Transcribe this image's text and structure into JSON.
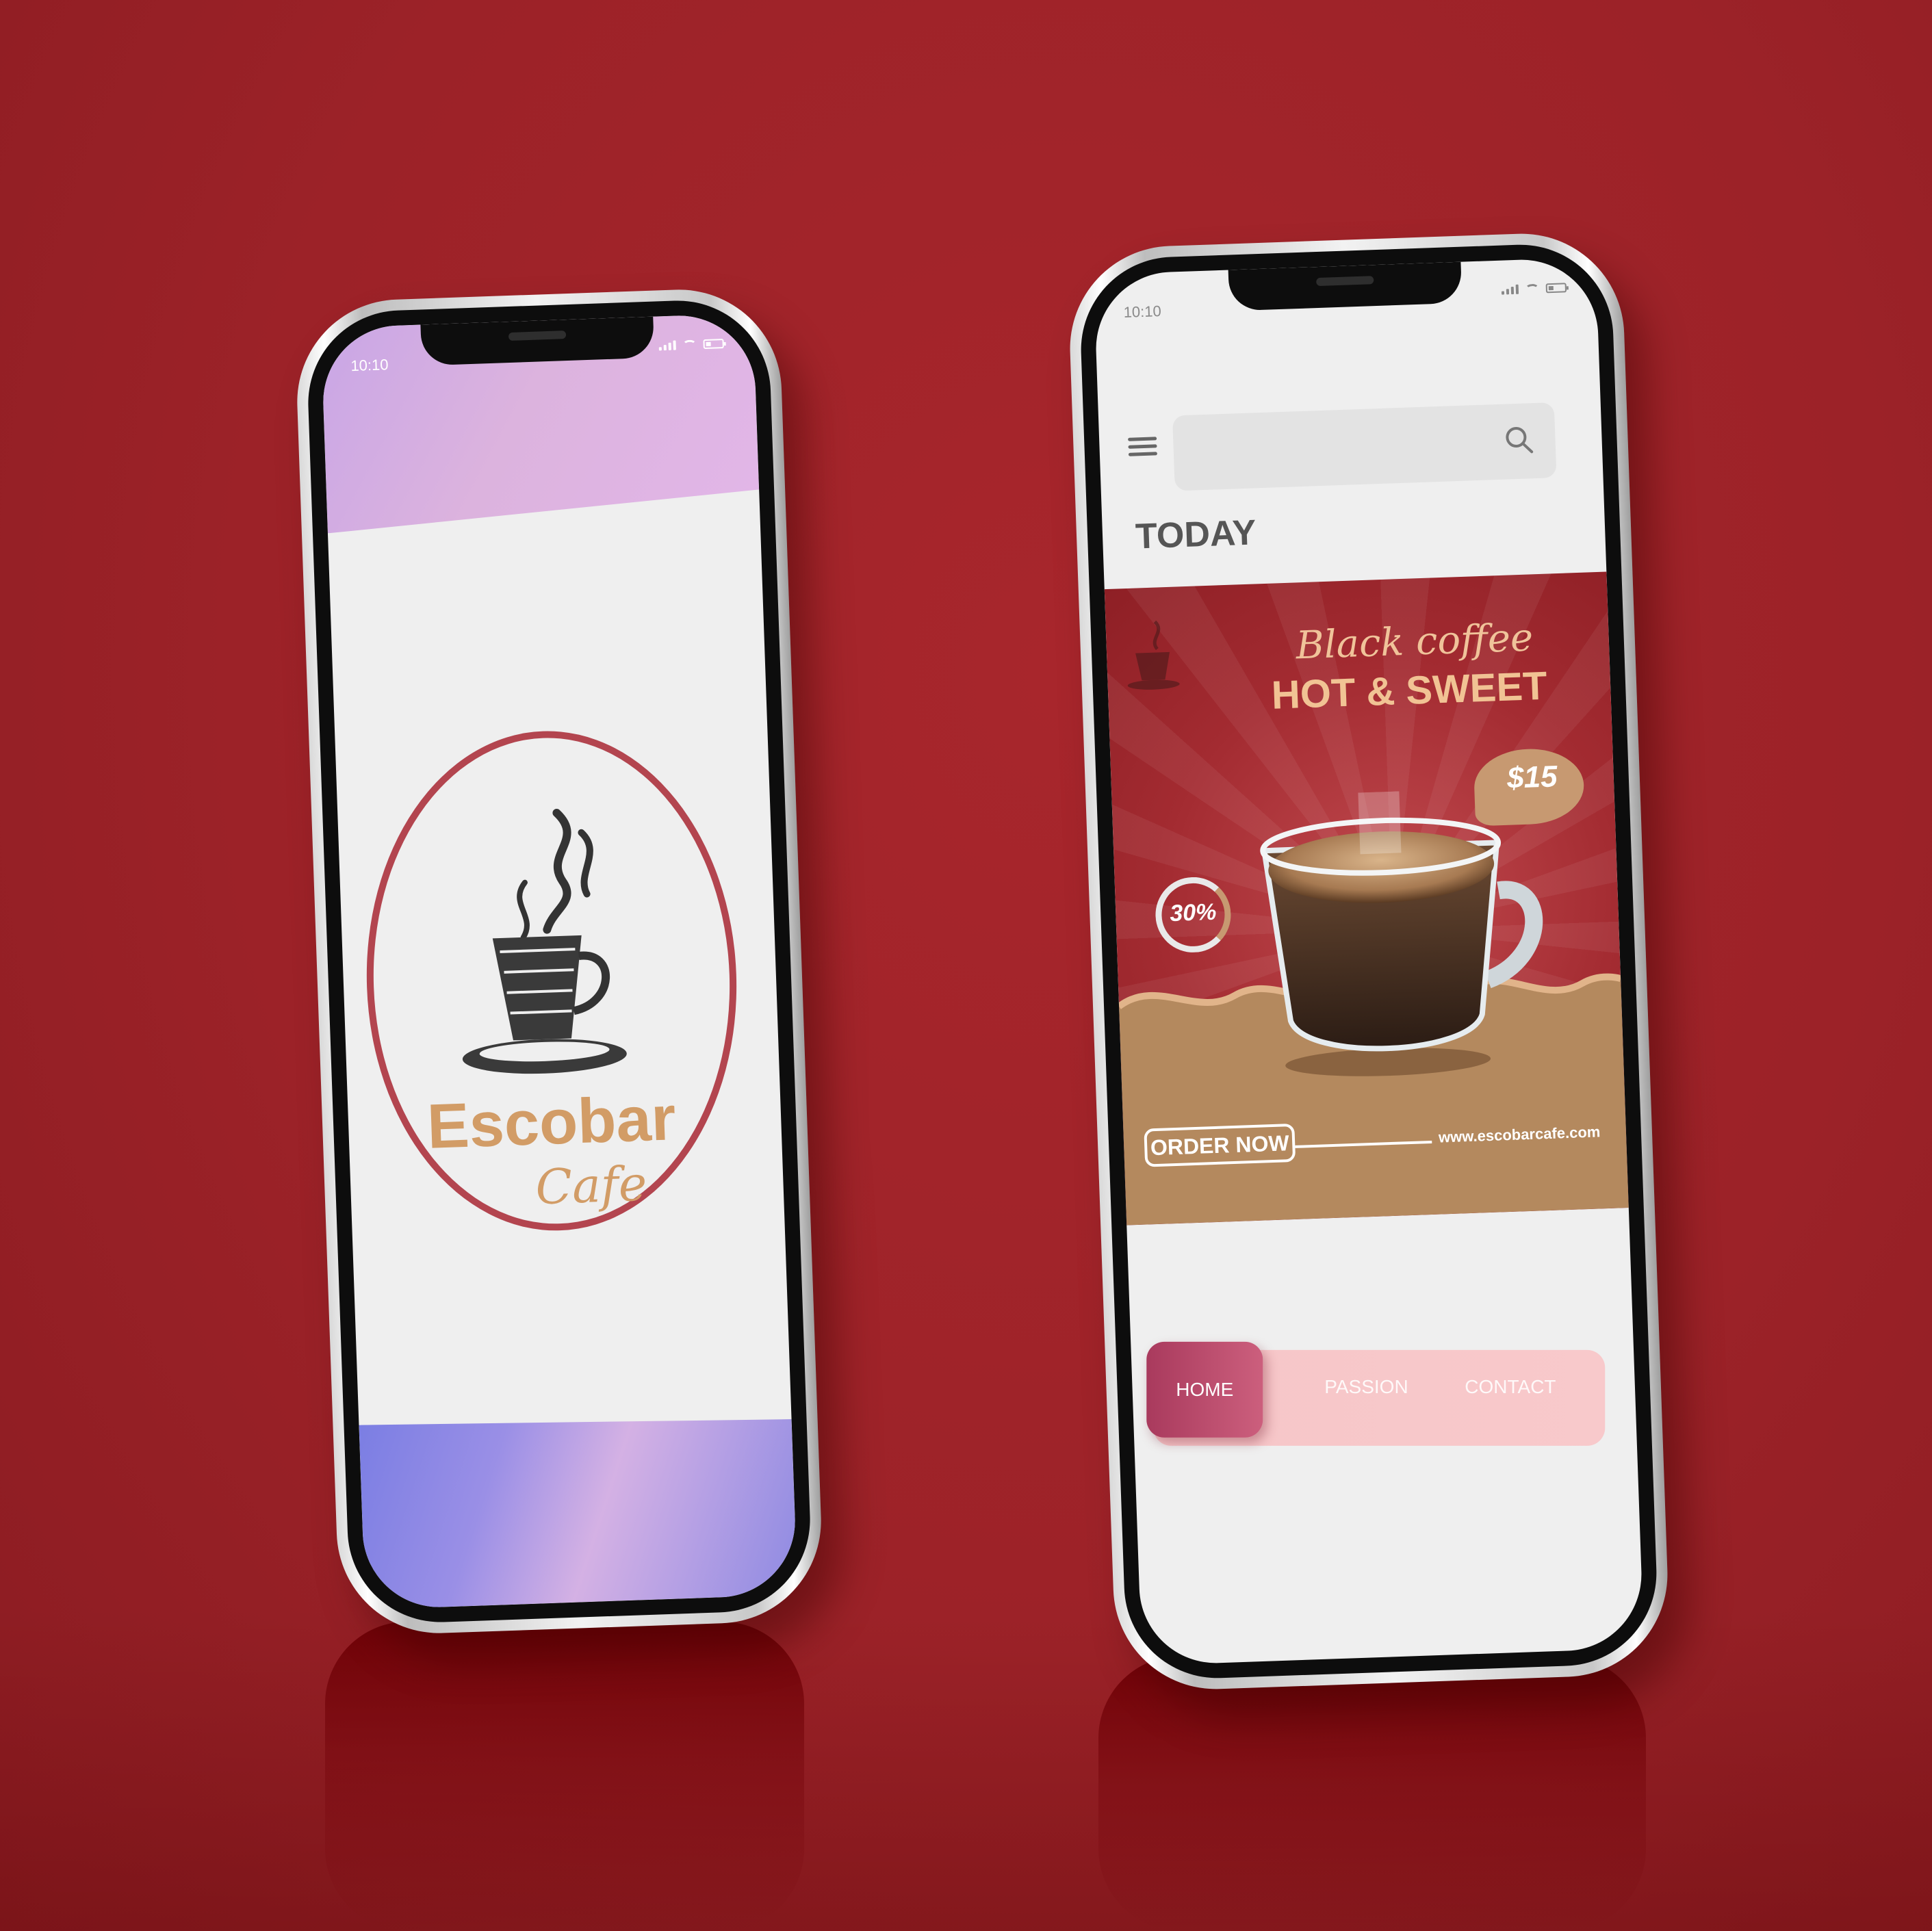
{
  "left_phone": {
    "status_time": "10:10",
    "brand_name": "Escobar",
    "brand_sub": "Cafe"
  },
  "right_phone": {
    "status_time": "10:10",
    "search_placeholder": "",
    "section_title": "TODAY",
    "promo": {
      "heading_script": "Black coffee",
      "heading_bold": "HOT & SWEET",
      "price": "$15",
      "discount": "30%",
      "cta": "ORDER NOW",
      "url": "www.escobarcafe.com"
    },
    "tabs": {
      "home": "HOME",
      "passion": "PASSION",
      "contact": "CONTACT"
    }
  },
  "colors": {
    "background": "#9c2228",
    "accent_brown": "#d29c66",
    "ring": "#b3454f",
    "tab_active": "#b8496b",
    "tab_bar": "#f6c6c8"
  }
}
